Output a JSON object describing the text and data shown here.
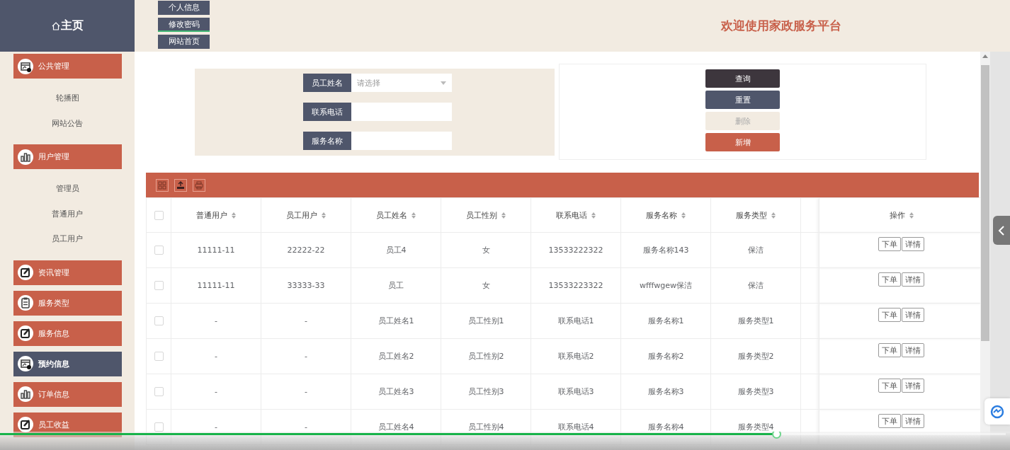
{
  "sidebar": {
    "home": {
      "label": "主页"
    },
    "groups": [
      {
        "label": "公共管理",
        "kind": "calendar",
        "selected": false,
        "children": [
          {
            "label": "轮播图"
          },
          {
            "label": "网站公告"
          }
        ]
      },
      {
        "label": "用户管理",
        "kind": "chart",
        "selected": false,
        "children": [
          {
            "label": "管理员"
          },
          {
            "label": "普通用户"
          },
          {
            "label": "员工用户"
          }
        ]
      },
      {
        "label": "资讯管理",
        "kind": "edit",
        "selected": false
      },
      {
        "label": "服务类型",
        "kind": "clipboard",
        "selected": false
      },
      {
        "label": "服务信息",
        "kind": "edit",
        "selected": false
      },
      {
        "label": "预约信息",
        "kind": "calendar",
        "selected": true
      },
      {
        "label": "订单信息",
        "kind": "chart",
        "selected": false
      },
      {
        "label": "员工收益",
        "kind": "edit",
        "selected": false
      }
    ]
  },
  "top_nav": [
    {
      "label": "个人信息",
      "selected": false
    },
    {
      "label": "修改密码",
      "selected": true
    },
    {
      "label": "网站首页",
      "selected": false
    }
  ],
  "header": {
    "title": "欢迎使用家政服务平台"
  },
  "search": {
    "fields": [
      {
        "label": "员工姓名",
        "kind": "select",
        "placeholder": "请选择"
      },
      {
        "label": "联系电话",
        "kind": "text"
      },
      {
        "label": "服务名称",
        "kind": "text"
      }
    ],
    "buttons": [
      {
        "label": "查询",
        "kind": "query",
        "disabled": false
      },
      {
        "label": "重置",
        "kind": "reset",
        "disabled": false
      },
      {
        "label": "删除",
        "kind": "delete",
        "disabled": true
      },
      {
        "label": "新增",
        "kind": "add",
        "disabled": false
      }
    ]
  },
  "table": {
    "select_all": {
      "checked": false
    },
    "tools": [
      {
        "kind": "columns"
      },
      {
        "kind": "export"
      },
      {
        "kind": "print"
      }
    ],
    "columns": [
      "普通用户",
      "员工用户",
      "员工姓名",
      "员工性别",
      "联系电话",
      "服务名称",
      "服务类型"
    ],
    "action_column": "操作",
    "rows": [
      {
        "checked": false,
        "cells": [
          "11111-11",
          "22222-22",
          "员工4",
          "女",
          "13533222322",
          "服务名称143",
          "保洁"
        ],
        "actions": [
          "下单",
          "详情"
        ]
      },
      {
        "checked": false,
        "cells": [
          "11111-11",
          "33333-33",
          "员工",
          "女",
          "13533223322",
          "wfffwgew保洁",
          "保洁"
        ],
        "actions": [
          "下单",
          "详情"
        ]
      },
      {
        "checked": false,
        "cells": [
          "-",
          "-",
          "员工姓名1",
          "员工性别1",
          "联系电话1",
          "服务名称1",
          "服务类型1"
        ],
        "actions": [
          "下单",
          "详情"
        ]
      },
      {
        "checked": false,
        "cells": [
          "-",
          "-",
          "员工姓名2",
          "员工性别2",
          "联系电话2",
          "服务名称2",
          "服务类型2"
        ],
        "actions": [
          "下单",
          "详情"
        ]
      },
      {
        "checked": false,
        "cells": [
          "-",
          "-",
          "员工姓名3",
          "员工性别3",
          "联系电话3",
          "服务名称3",
          "服务类型3"
        ],
        "actions": [
          "下单",
          "详情"
        ]
      },
      {
        "checked": false,
        "cells": [
          "-",
          "-",
          "员工姓名4",
          "员工性别4",
          "联系电话4",
          "服务名称4",
          "服务类型4"
        ],
        "actions": [
          "下单",
          "详情"
        ]
      }
    ]
  },
  "video_player": {
    "level": 0.772
  }
}
